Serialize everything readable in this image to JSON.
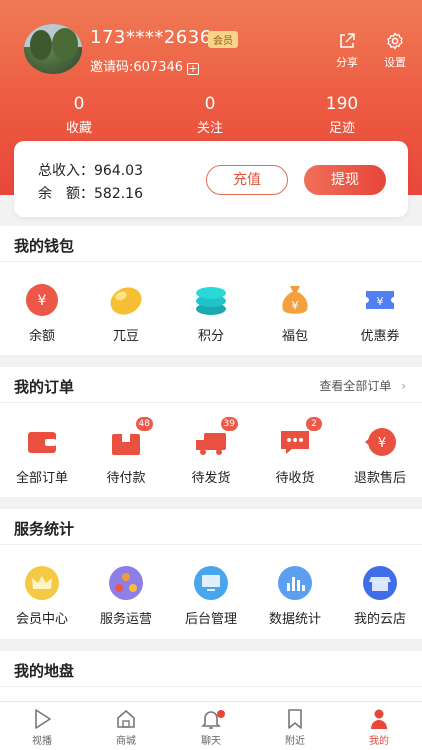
{
  "profile": {
    "phone": "173****2636",
    "vip_label": "会员",
    "invite_label": "邀请码:607346",
    "share_label": "分享",
    "settings_label": "设置"
  },
  "stats": [
    {
      "value": "0",
      "label": "收藏"
    },
    {
      "value": "0",
      "label": "关注"
    },
    {
      "value": "190",
      "label": "足迹"
    }
  ],
  "balance": {
    "income_label": "总收入：",
    "income_value": "964.03",
    "balance_label": "余　额：",
    "balance_value": "582.16",
    "recharge_label": "充值",
    "withdraw_label": "提现"
  },
  "wallet": {
    "title": "我的钱包",
    "items": [
      {
        "label": "余额",
        "icon": "yen-coin-icon"
      },
      {
        "label": "兀豆",
        "icon": "bean-icon"
      },
      {
        "label": "积分",
        "icon": "coin-stack-icon"
      },
      {
        "label": "福包",
        "icon": "money-bag-icon"
      },
      {
        "label": "优惠券",
        "icon": "coupon-icon"
      }
    ]
  },
  "orders": {
    "title": "我的订单",
    "more_label": "查看全部订单",
    "items": [
      {
        "label": "全部订单",
        "icon": "wallet-icon",
        "badge": ""
      },
      {
        "label": "待付款",
        "icon": "package-icon",
        "badge": "48"
      },
      {
        "label": "待发货",
        "icon": "truck-icon",
        "badge": "39"
      },
      {
        "label": "待收货",
        "icon": "message-icon",
        "badge": "2"
      },
      {
        "label": "退款售后",
        "icon": "refund-icon",
        "badge": ""
      }
    ]
  },
  "services": {
    "title": "服务统计",
    "items": [
      {
        "label": "会员中心",
        "icon": "crown-icon"
      },
      {
        "label": "服务运营",
        "icon": "network-icon"
      },
      {
        "label": "后台管理",
        "icon": "monitor-icon"
      },
      {
        "label": "数据统计",
        "icon": "bar-chart-icon"
      },
      {
        "label": "我的云店",
        "icon": "store-icon"
      }
    ]
  },
  "territory": {
    "title": "我的地盘"
  },
  "tabbar": {
    "items": [
      {
        "label": "视播",
        "icon": "play-icon"
      },
      {
        "label": "商城",
        "icon": "home-icon"
      },
      {
        "label": "聊天",
        "icon": "bell-icon"
      },
      {
        "label": "附近",
        "icon": "bookmark-icon"
      },
      {
        "label": "我的",
        "icon": "person-icon"
      }
    ]
  },
  "colors": {
    "accent": "#e8473a",
    "header_top": "#f07a55",
    "badge": "#ec5a4a"
  }
}
